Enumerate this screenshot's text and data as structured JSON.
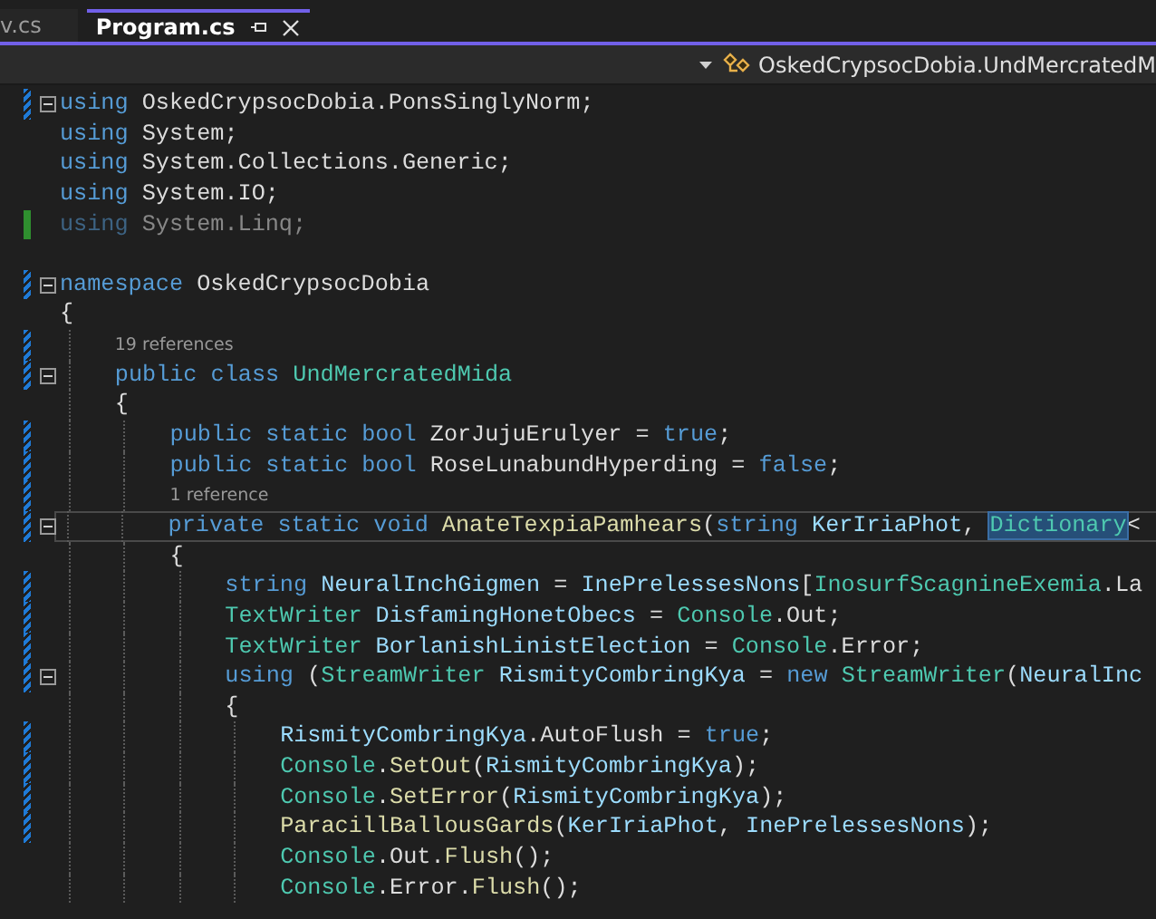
{
  "tabs": [
    {
      "label": "v.cs",
      "selected": false
    },
    {
      "label": "Program.cs",
      "selected": true
    }
  ],
  "nav_bar": {
    "breadcrumb": "OskedCrypsocDobia.UndMercratedM"
  },
  "editor": {
    "lines": [
      {
        "kind": "code",
        "reverted": true,
        "foldable": true,
        "tokens": [
          {
            "kind": "keyword",
            "text": "using"
          },
          {
            "kind": "plain",
            "text": " OskedCrypsocDobia.PonsSinglyNorm;"
          }
        ]
      },
      {
        "kind": "code",
        "tokens": [
          {
            "kind": "keyword",
            "text": "using"
          },
          {
            "kind": "plain",
            "text": " System;"
          }
        ]
      },
      {
        "kind": "code",
        "tokens": [
          {
            "kind": "keyword",
            "text": "using"
          },
          {
            "kind": "plain",
            "text": " System.Collections.Generic;"
          }
        ]
      },
      {
        "kind": "code",
        "tokens": [
          {
            "kind": "keyword",
            "text": "using"
          },
          {
            "kind": "plain",
            "text": " System.IO;"
          }
        ]
      },
      {
        "kind": "code",
        "saved": true,
        "unused": true,
        "tokens": [
          {
            "kind": "keyword",
            "text": "using"
          },
          {
            "kind": "plain",
            "text": " System.Linq;"
          }
        ]
      },
      {
        "kind": "blank"
      },
      {
        "kind": "code",
        "reverted": true,
        "foldable": true,
        "tokens": [
          {
            "kind": "keyword",
            "text": "namespace"
          },
          {
            "kind": "plain",
            "text": " OskedCrypsocDobia"
          }
        ]
      },
      {
        "kind": "code",
        "tokens": [
          {
            "kind": "plain",
            "text": "{"
          }
        ],
        "children": [
          {
            "kind": "lens",
            "reverted": true,
            "text": "19 references"
          },
          {
            "kind": "code",
            "reverted": true,
            "foldable": true,
            "tokens": [
              {
                "kind": "keyword",
                "text": "public class"
              },
              {
                "kind": "type",
                "text": " UndMercratedMida"
              }
            ]
          },
          {
            "kind": "code",
            "tokens": [
              {
                "kind": "plain",
                "text": "{"
              }
            ],
            "children": [
              {
                "kind": "code",
                "reverted": true,
                "tokens": [
                  {
                    "kind": "keyword",
                    "text": "public static bool"
                  },
                  {
                    "kind": "plain",
                    "text": " ZorJujuErulyer = "
                  },
                  {
                    "kind": "keyword",
                    "text": "true"
                  },
                  {
                    "kind": "plain",
                    "text": ";"
                  }
                ]
              },
              {
                "kind": "code",
                "reverted": true,
                "tokens": [
                  {
                    "kind": "keyword",
                    "text": "public static bool"
                  },
                  {
                    "kind": "plain",
                    "text": " RoseLunabundHyperding = "
                  },
                  {
                    "kind": "keyword",
                    "text": "false"
                  },
                  {
                    "kind": "plain",
                    "text": ";"
                  }
                ]
              },
              {
                "kind": "lens",
                "reverted": true,
                "text": "1 reference"
              },
              {
                "kind": "code",
                "reverted": true,
                "foldable": true,
                "current": true,
                "tokens": [
                  {
                    "kind": "keyword",
                    "text": "private static void"
                  },
                  {
                    "kind": "method",
                    "text": " AnateTexpiaPamhears"
                  },
                  {
                    "kind": "plain",
                    "text": "("
                  },
                  {
                    "kind": "keyword",
                    "text": "string"
                  },
                  {
                    "kind": "variable",
                    "text": " KerIriaPhot"
                  },
                  {
                    "kind": "plain",
                    "text": ", "
                  },
                  {
                    "kind": "type",
                    "text": "Dictionary",
                    "highlighted": true
                  },
                  {
                    "kind": "plain",
                    "text": "<"
                  }
                ]
              },
              {
                "kind": "code",
                "tokens": [
                  {
                    "kind": "plain",
                    "text": "{"
                  }
                ],
                "children": [
                  {
                    "kind": "code",
                    "reverted": true,
                    "tokens": [
                      {
                        "kind": "keyword",
                        "text": "string"
                      },
                      {
                        "kind": "variable",
                        "text": " NeuralInchGigmen"
                      },
                      {
                        "kind": "plain",
                        "text": " = "
                      },
                      {
                        "kind": "variable",
                        "text": "InePrelessesNons"
                      },
                      {
                        "kind": "plain",
                        "text": "["
                      },
                      {
                        "kind": "type",
                        "text": "InosurfScagnineExemia"
                      },
                      {
                        "kind": "plain",
                        "text": ".La"
                      }
                    ]
                  },
                  {
                    "kind": "code",
                    "reverted": true,
                    "tokens": [
                      {
                        "kind": "type",
                        "text": "TextWriter"
                      },
                      {
                        "kind": "variable",
                        "text": " DisfamingHonetObecs"
                      },
                      {
                        "kind": "plain",
                        "text": " = "
                      },
                      {
                        "kind": "type",
                        "text": "Console"
                      },
                      {
                        "kind": "plain",
                        "text": ".Out;"
                      }
                    ]
                  },
                  {
                    "kind": "code",
                    "reverted": true,
                    "tokens": [
                      {
                        "kind": "type",
                        "text": "TextWriter"
                      },
                      {
                        "kind": "variable",
                        "text": " BorlanishLinistElection"
                      },
                      {
                        "kind": "plain",
                        "text": " = "
                      },
                      {
                        "kind": "type",
                        "text": "Console"
                      },
                      {
                        "kind": "plain",
                        "text": ".Error;"
                      }
                    ]
                  },
                  {
                    "kind": "code",
                    "reverted": true,
                    "foldable": true,
                    "tokens": [
                      {
                        "kind": "keyword",
                        "text": "using"
                      },
                      {
                        "kind": "plain",
                        "text": " ("
                      },
                      {
                        "kind": "type",
                        "text": "StreamWriter"
                      },
                      {
                        "kind": "variable",
                        "text": " RismityCombringKya"
                      },
                      {
                        "kind": "plain",
                        "text": " = "
                      },
                      {
                        "kind": "keyword",
                        "text": "new"
                      },
                      {
                        "kind": "type",
                        "text": " StreamWriter"
                      },
                      {
                        "kind": "plain",
                        "text": "("
                      },
                      {
                        "kind": "variable",
                        "text": "NeuralInc"
                      }
                    ]
                  },
                  {
                    "kind": "code",
                    "tokens": [
                      {
                        "kind": "plain",
                        "text": "{"
                      }
                    ],
                    "children": [
                      {
                        "kind": "code",
                        "reverted": true,
                        "tokens": [
                          {
                            "kind": "variable",
                            "text": "RismityCombringKya"
                          },
                          {
                            "kind": "plain",
                            "text": ".AutoFlush = "
                          },
                          {
                            "kind": "keyword",
                            "text": "true"
                          },
                          {
                            "kind": "plain",
                            "text": ";"
                          }
                        ]
                      },
                      {
                        "kind": "code",
                        "reverted": true,
                        "tokens": [
                          {
                            "kind": "type",
                            "text": "Console"
                          },
                          {
                            "kind": "plain",
                            "text": "."
                          },
                          {
                            "kind": "method",
                            "text": "SetOut"
                          },
                          {
                            "kind": "plain",
                            "text": "("
                          },
                          {
                            "kind": "variable",
                            "text": "RismityCombringKya"
                          },
                          {
                            "kind": "plain",
                            "text": ");"
                          }
                        ]
                      },
                      {
                        "kind": "code",
                        "reverted": true,
                        "tokens": [
                          {
                            "kind": "type",
                            "text": "Console"
                          },
                          {
                            "kind": "plain",
                            "text": "."
                          },
                          {
                            "kind": "method",
                            "text": "SetError"
                          },
                          {
                            "kind": "plain",
                            "text": "("
                          },
                          {
                            "kind": "variable",
                            "text": "RismityCombringKya"
                          },
                          {
                            "kind": "plain",
                            "text": ");"
                          }
                        ]
                      },
                      {
                        "kind": "code",
                        "reverted": true,
                        "tokens": [
                          {
                            "kind": "method",
                            "text": "ParacillBallousGards"
                          },
                          {
                            "kind": "plain",
                            "text": "("
                          },
                          {
                            "kind": "variable",
                            "text": "KerIriaPhot"
                          },
                          {
                            "kind": "plain",
                            "text": ", "
                          },
                          {
                            "kind": "variable",
                            "text": "InePrelessesNons"
                          },
                          {
                            "kind": "plain",
                            "text": ");"
                          }
                        ]
                      },
                      {
                        "kind": "code",
                        "tokens": [
                          {
                            "kind": "type",
                            "text": "Console"
                          },
                          {
                            "kind": "plain",
                            "text": ".Out."
                          },
                          {
                            "kind": "method",
                            "text": "Flush"
                          },
                          {
                            "kind": "plain",
                            "text": "();"
                          }
                        ]
                      },
                      {
                        "kind": "code",
                        "tokens": [
                          {
                            "kind": "type",
                            "text": "Console"
                          },
                          {
                            "kind": "plain",
                            "text": ".Error."
                          },
                          {
                            "kind": "method",
                            "text": "Flush"
                          },
                          {
                            "kind": "plain",
                            "text": "();"
                          }
                        ]
                      }
                    ]
                  }
                ]
              }
            ]
          }
        ]
      }
    ]
  }
}
